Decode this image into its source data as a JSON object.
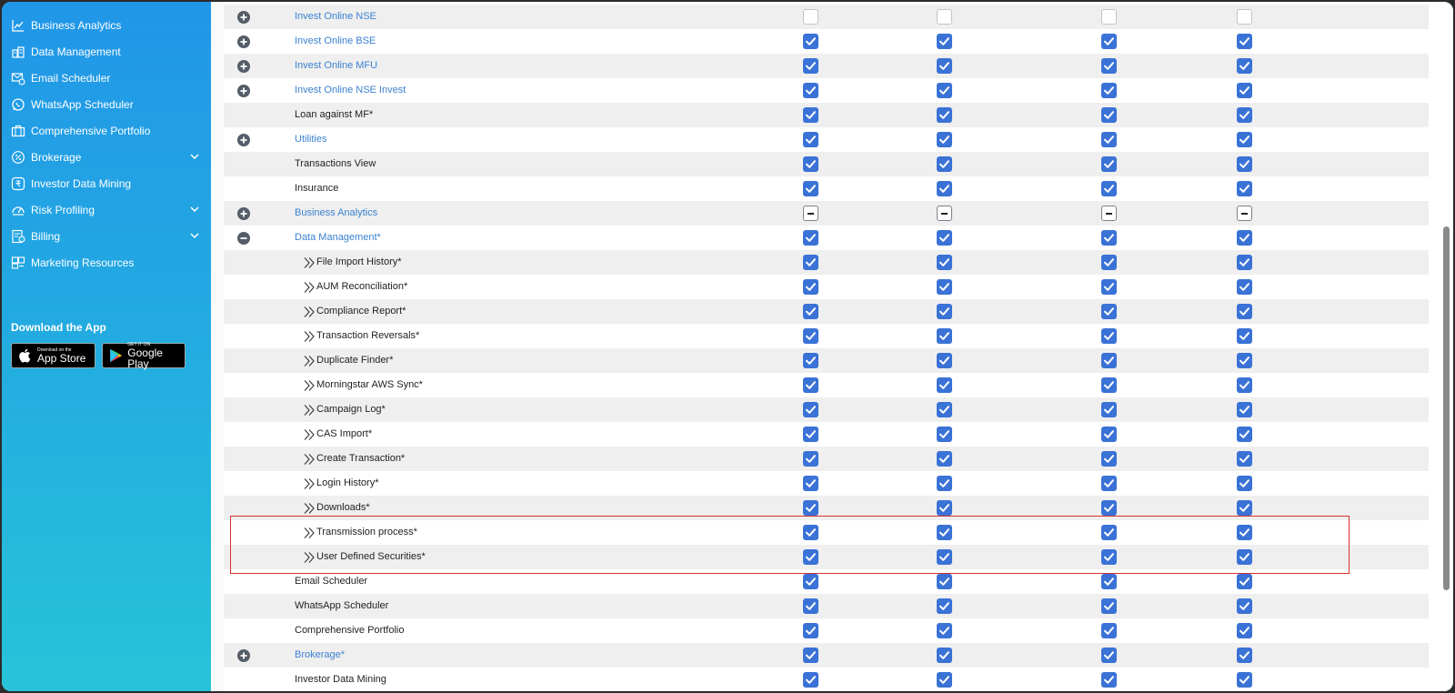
{
  "sidebar": {
    "items": [
      {
        "label": "Business Analytics",
        "icon": "chart-line-icon",
        "chevron": false
      },
      {
        "label": "Data Management",
        "icon": "database-icon",
        "chevron": false
      },
      {
        "label": "Email Scheduler",
        "icon": "email-clock-icon",
        "chevron": false
      },
      {
        "label": "WhatsApp Scheduler",
        "icon": "whatsapp-icon",
        "chevron": false
      },
      {
        "label": "Comprehensive Portfolio",
        "icon": "briefcase-icon",
        "chevron": false
      },
      {
        "label": "Brokerage",
        "icon": "percent-badge-icon",
        "chevron": true
      },
      {
        "label": "Investor Data Mining",
        "icon": "rupee-box-icon",
        "chevron": false
      },
      {
        "label": "Risk Profiling",
        "icon": "gauge-icon",
        "chevron": true
      },
      {
        "label": "Billing",
        "icon": "invoice-icon",
        "chevron": true
      },
      {
        "label": "Marketing Resources",
        "icon": "megaphone-icon",
        "chevron": false
      }
    ],
    "download": {
      "title": "Download the App",
      "app_store": {
        "small": "Download on the",
        "big": "App Store"
      },
      "google_play": {
        "small": "GET IT ON",
        "big": "Google Play"
      }
    }
  },
  "rows": [
    {
      "label": "Invest Online NSE",
      "link": true,
      "toggle": "plus",
      "indent": 0,
      "state": "empty"
    },
    {
      "label": "Invest Online BSE",
      "link": true,
      "toggle": "plus",
      "indent": 0,
      "state": "checked"
    },
    {
      "label": "Invest Online MFU",
      "link": true,
      "toggle": "plus",
      "indent": 0,
      "state": "checked"
    },
    {
      "label": "Invest Online NSE Invest",
      "link": true,
      "toggle": "plus",
      "indent": 0,
      "state": "checked"
    },
    {
      "label": "Loan against MF*",
      "link": false,
      "toggle": "",
      "indent": 0,
      "state": "checked"
    },
    {
      "label": "Utilities",
      "link": true,
      "toggle": "plus",
      "indent": 0,
      "state": "checked"
    },
    {
      "label": "Transactions View",
      "link": false,
      "toggle": "",
      "indent": 0,
      "state": "checked"
    },
    {
      "label": "Insurance",
      "link": false,
      "toggle": "",
      "indent": 0,
      "state": "checked"
    },
    {
      "label": "Business Analytics",
      "link": true,
      "toggle": "plus",
      "indent": 0,
      "state": "indeterminate"
    },
    {
      "label": "Data Management*",
      "link": true,
      "toggle": "minus",
      "indent": 0,
      "state": "checked"
    },
    {
      "label": "File Import History*",
      "link": false,
      "toggle": "",
      "indent": 1,
      "state": "checked"
    },
    {
      "label": "AUM Reconciliation*",
      "link": false,
      "toggle": "",
      "indent": 1,
      "state": "checked"
    },
    {
      "label": "Compliance Report*",
      "link": false,
      "toggle": "",
      "indent": 1,
      "state": "checked"
    },
    {
      "label": "Transaction Reversals*",
      "link": false,
      "toggle": "",
      "indent": 1,
      "state": "checked"
    },
    {
      "label": "Duplicate Finder*",
      "link": false,
      "toggle": "",
      "indent": 1,
      "state": "checked"
    },
    {
      "label": "Morningstar AWS Sync*",
      "link": false,
      "toggle": "",
      "indent": 1,
      "state": "checked"
    },
    {
      "label": "Campaign Log*",
      "link": false,
      "toggle": "",
      "indent": 1,
      "state": "checked"
    },
    {
      "label": "CAS Import*",
      "link": false,
      "toggle": "",
      "indent": 1,
      "state": "checked"
    },
    {
      "label": "Create Transaction*",
      "link": false,
      "toggle": "",
      "indent": 1,
      "state": "checked"
    },
    {
      "label": "Login History*",
      "link": false,
      "toggle": "",
      "indent": 1,
      "state": "checked"
    },
    {
      "label": "Downloads*",
      "link": false,
      "toggle": "",
      "indent": 1,
      "state": "checked"
    },
    {
      "label": "Transmission process*",
      "link": false,
      "toggle": "",
      "indent": 1,
      "state": "checked"
    },
    {
      "label": "User Defined Securities*",
      "link": false,
      "toggle": "",
      "indent": 1,
      "state": "checked"
    },
    {
      "label": "Email Scheduler",
      "link": false,
      "toggle": "",
      "indent": 0,
      "state": "checked"
    },
    {
      "label": "WhatsApp Scheduler",
      "link": false,
      "toggle": "",
      "indent": 0,
      "state": "checked"
    },
    {
      "label": "Comprehensive Portfolio",
      "link": false,
      "toggle": "",
      "indent": 0,
      "state": "checked"
    },
    {
      "label": "Brokerage*",
      "link": true,
      "toggle": "plus",
      "indent": 0,
      "state": "checked"
    },
    {
      "label": "Investor Data Mining",
      "link": false,
      "toggle": "",
      "indent": 0,
      "state": "checked"
    }
  ],
  "colors": {
    "checkbox": "#3a72d6",
    "link": "#3b82d1",
    "highlight": "#d9302c"
  }
}
